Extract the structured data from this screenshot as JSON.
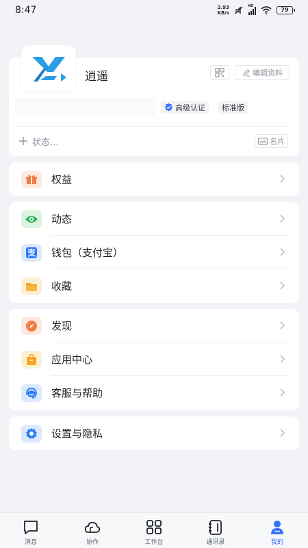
{
  "status_bar": {
    "time": "8:47",
    "net_speed_value": "2.93",
    "net_speed_unit": "KB/s",
    "battery": "79",
    "hd_label": "HD"
  },
  "profile": {
    "name": "逍遥",
    "edit_label": "编辑资料",
    "cert_label": "高级认证",
    "edition_label": "标准版",
    "status_placeholder": "状态...",
    "card_label": "名片",
    "avatar_icon": "yl-logo-icon"
  },
  "menu_groups": [
    {
      "items": [
        {
          "label": "权益",
          "icon": "gift-icon",
          "color": "#f07c4a"
        }
      ]
    },
    {
      "items": [
        {
          "label": "动态",
          "icon": "eye-icon",
          "color": "#34b35a"
        },
        {
          "label": "钱包（支付宝）",
          "icon": "alipay-icon",
          "color": "#2f7cf6"
        },
        {
          "label": "收藏",
          "icon": "folder-icon",
          "color": "#f5a623"
        }
      ]
    },
    {
      "items": [
        {
          "label": "发现",
          "icon": "compass-icon",
          "color": "#f07c4a"
        },
        {
          "label": "应用中心",
          "icon": "bag-icon",
          "color": "#f5a623"
        },
        {
          "label": "客服与帮助",
          "icon": "headset-icon",
          "color": "#2f7cf6"
        }
      ]
    },
    {
      "items": [
        {
          "label": "设置与隐私",
          "icon": "gear-icon",
          "color": "#2f7cf6"
        }
      ]
    }
  ],
  "bottom_nav": [
    {
      "label": "消息",
      "icon": "message-icon",
      "active": false
    },
    {
      "label": "协作",
      "icon": "cloud-icon",
      "active": false
    },
    {
      "label": "工作台",
      "icon": "grid-icon",
      "active": false
    },
    {
      "label": "通讯录",
      "icon": "contacts-icon",
      "active": false
    },
    {
      "label": "我的",
      "icon": "person-icon",
      "active": true
    }
  ],
  "colors": {
    "accent": "#3370ff",
    "background": "#f2f3f7",
    "card": "#ffffff"
  }
}
